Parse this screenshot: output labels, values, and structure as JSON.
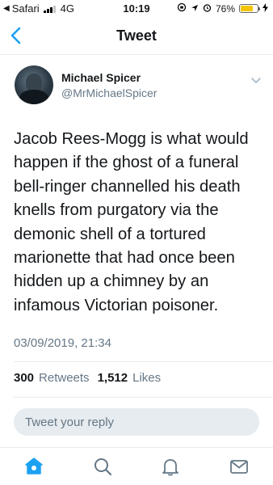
{
  "status_bar": {
    "back_app": "Safari",
    "network": "4G",
    "time": "10:19",
    "battery": "76%",
    "battery_level": 0.76,
    "battery_color": "#f5c400"
  },
  "nav": {
    "title": "Tweet",
    "back_icon": "chevron-left-icon"
  },
  "tweet": {
    "author_name": "Michael Spicer",
    "author_handle": "@MrMichaelSpicer",
    "text": "Jacob Rees-Mogg is what would\nhappen if the ghost of a funeral\nbell-ringer channelled his death\nknells from purgatory via the\ndemonic shell of a tortured\nmarionette that had once been\nhidden up a chimney by an\ninfamous Victorian poisoner.",
    "timestamp": "03/09/2019, 21:34",
    "retweets_count": "300",
    "retweets_label": "Retweets",
    "likes_count": "1,512",
    "likes_label": "Likes"
  },
  "reply": {
    "placeholder": "Tweet your reply"
  },
  "tabs": [
    {
      "icon": "home-icon",
      "active": true
    },
    {
      "icon": "search-icon",
      "active": false
    },
    {
      "icon": "bell-icon",
      "active": false
    },
    {
      "icon": "mail-icon",
      "active": false
    }
  ],
  "colors": {
    "accent": "#1da1f2",
    "secondary_text": "#657786",
    "divider": "#e6ecf0"
  }
}
